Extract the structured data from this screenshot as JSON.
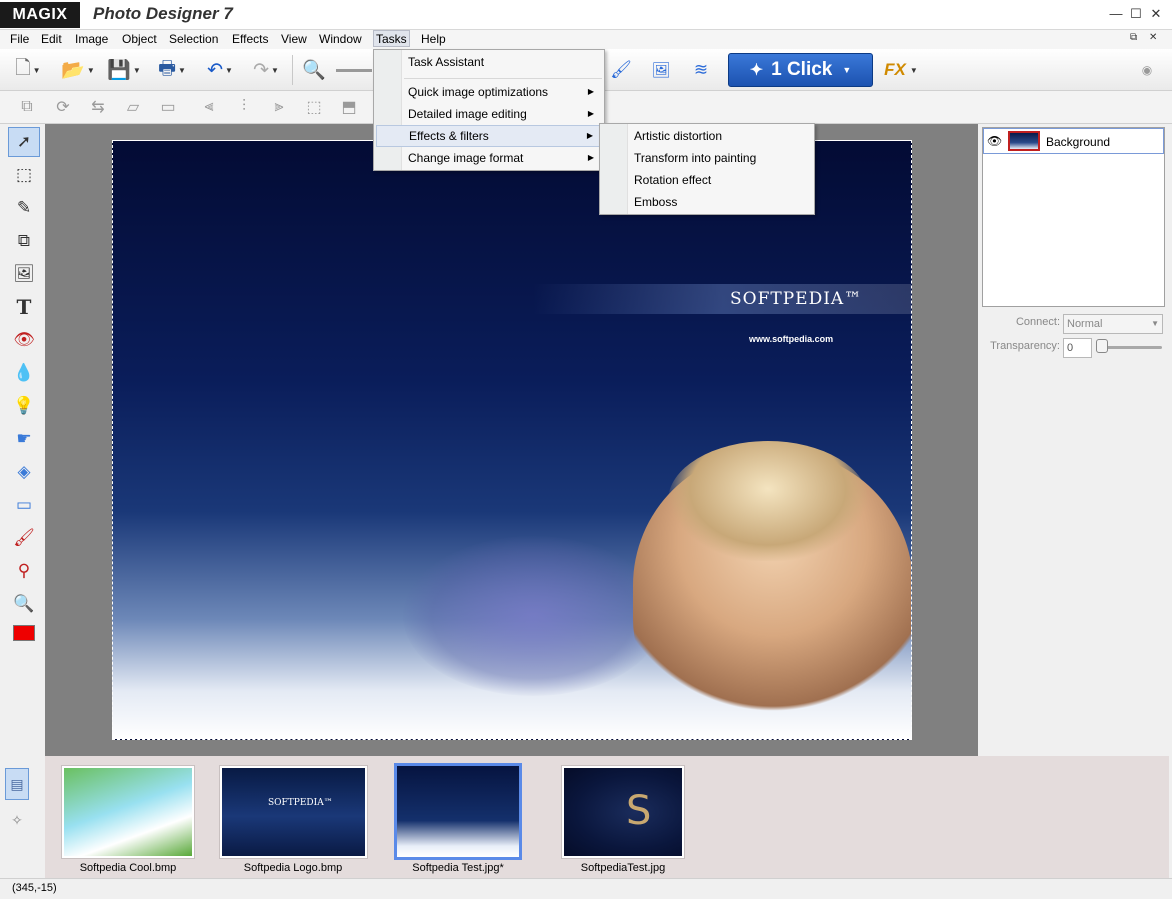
{
  "titlebar": {
    "brand": "MAGIX",
    "app_title": "Photo Designer 7",
    "minimize": "—",
    "maximize": "☐",
    "close": "✕"
  },
  "menubar": {
    "items": [
      "File",
      "Edit",
      "Image",
      "Object",
      "Selection",
      "Effects",
      "View",
      "Window",
      "Tasks",
      "Help"
    ],
    "open_menu": "Tasks",
    "mdi_restore": "⧉",
    "mdi_close": "✕"
  },
  "toolbar": {
    "one_click_label": "1 Click",
    "fx_label": "FX",
    "icons": [
      "new-icon",
      "open-icon",
      "save-icon",
      "print-icon",
      "undo-icon",
      "redo-icon",
      "zoom-icon"
    ]
  },
  "tasks_menu": {
    "items": [
      {
        "label": "Task Assistant",
        "submenu": false
      },
      {
        "label": "Quick image optimizations",
        "submenu": true
      },
      {
        "label": "Detailed image editing",
        "submenu": true
      },
      {
        "label": "Effects & filters",
        "submenu": true,
        "highlighted": true
      },
      {
        "label": "Change image format",
        "submenu": true
      }
    ]
  },
  "effects_submenu": {
    "items": [
      "Artistic distortion",
      "Transform into painting",
      "Rotation effect",
      "Emboss"
    ]
  },
  "canvas": {
    "logo_text": "SOFTPEDIA™",
    "url_text": "www.softpedia.com"
  },
  "layers": {
    "items": [
      {
        "name": "Background",
        "visible": true
      }
    ]
  },
  "properties": {
    "connect_label": "Connect:",
    "connect_value": "Normal",
    "transparency_label": "Transparency:",
    "transparency_value": "0",
    "transparency_level": 0
  },
  "filmstrip": {
    "items": [
      {
        "label": "Softpedia Cool.bmp",
        "selected": false
      },
      {
        "label": "Softpedia Logo.bmp",
        "selected": false
      },
      {
        "label": "Softpedia Test.jpg*",
        "selected": true
      },
      {
        "label": "SoftpediaTest.jpg",
        "selected": false
      }
    ],
    "thumb_text_logo": "SOFTPEDIA™"
  },
  "statusbar": {
    "coords": "(345,-15)"
  },
  "colors": {
    "foreground": "#ee0000",
    "accent": "#2a66c8"
  }
}
